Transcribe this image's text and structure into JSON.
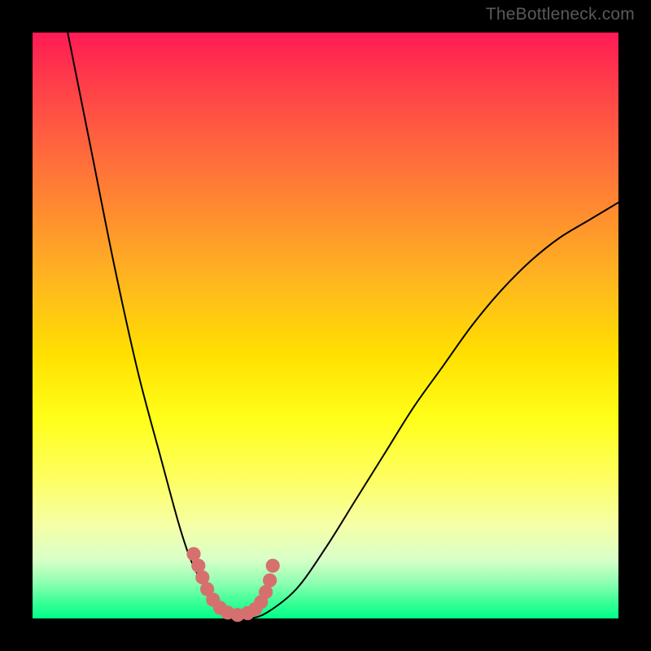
{
  "watermark": "TheBottleneck.com",
  "chart_data": {
    "type": "line",
    "title": "",
    "xlabel": "",
    "ylabel": "",
    "xlim": [
      0,
      100
    ],
    "ylim": [
      0,
      100
    ],
    "series": [
      {
        "name": "bottleneck-curve",
        "x": [
          6,
          10,
          14,
          18,
          22,
          25,
          27,
          29,
          31,
          33,
          35,
          37,
          40,
          45,
          50,
          55,
          60,
          65,
          70,
          75,
          80,
          85,
          90,
          95,
          100
        ],
        "y": [
          100,
          80,
          60,
          42,
          27,
          16,
          10,
          6,
          3,
          1,
          0,
          0,
          1,
          5,
          12,
          20,
          28,
          36,
          43,
          50,
          56,
          61,
          65,
          68,
          71
        ]
      }
    ],
    "markers": {
      "name": "threshold-points",
      "x": [
        27.5,
        28.3,
        29.0,
        29.8,
        30.8,
        32.0,
        33.3,
        35.0,
        36.7,
        38.0,
        39.0,
        39.8,
        40.5,
        41.0
      ],
      "y": [
        11.0,
        9.0,
        7.0,
        5.0,
        3.2,
        1.8,
        1.0,
        0.6,
        0.9,
        1.6,
        2.8,
        4.5,
        6.5,
        9.0
      ],
      "r": 1.2
    },
    "gradient_stops": [
      {
        "pos": 0,
        "color": "#00ff88"
      },
      {
        "pos": 6,
        "color": "#8cffb0"
      },
      {
        "pos": 16,
        "color": "#f6ffa6"
      },
      {
        "pos": 34,
        "color": "#ffff1a"
      },
      {
        "pos": 58,
        "color": "#ffb520"
      },
      {
        "pos": 82,
        "color": "#ff6040"
      },
      {
        "pos": 100,
        "color": "#ff1a55"
      }
    ]
  }
}
